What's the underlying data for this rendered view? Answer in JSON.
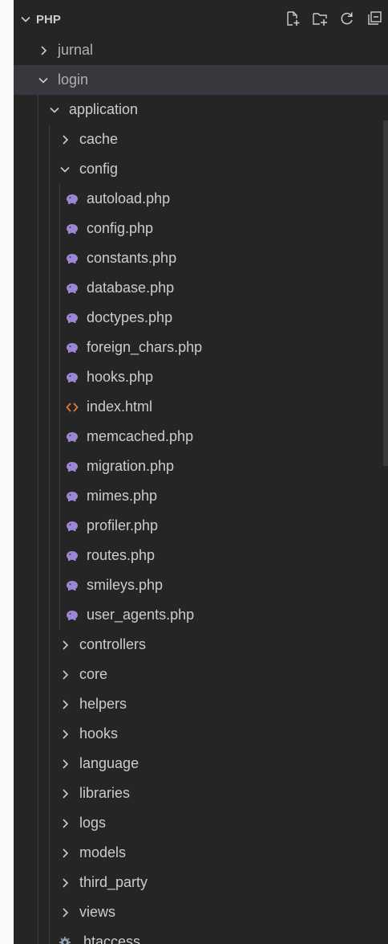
{
  "explorer": {
    "section_title": "PHP",
    "actions": [
      {
        "name": "new-file-icon"
      },
      {
        "name": "new-folder-icon"
      },
      {
        "name": "refresh-icon"
      },
      {
        "name": "collapse-all-icon"
      }
    ]
  },
  "tree": [
    {
      "label": "jurnal",
      "type": "folder",
      "expanded": false,
      "depth": 1
    },
    {
      "label": "login",
      "type": "folder",
      "expanded": true,
      "depth": 1,
      "selected": true
    },
    {
      "label": "application",
      "type": "folder",
      "expanded": true,
      "depth": 2
    },
    {
      "label": "cache",
      "type": "folder",
      "expanded": false,
      "depth": 3
    },
    {
      "label": "config",
      "type": "folder",
      "expanded": true,
      "depth": 3
    },
    {
      "label": "autoload.php",
      "type": "php",
      "depth": 4
    },
    {
      "label": "config.php",
      "type": "php",
      "depth": 4
    },
    {
      "label": "constants.php",
      "type": "php",
      "depth": 4
    },
    {
      "label": "database.php",
      "type": "php",
      "depth": 4
    },
    {
      "label": "doctypes.php",
      "type": "php",
      "depth": 4
    },
    {
      "label": "foreign_chars.php",
      "type": "php",
      "depth": 4
    },
    {
      "label": "hooks.php",
      "type": "php",
      "depth": 4
    },
    {
      "label": "index.html",
      "type": "html",
      "depth": 4
    },
    {
      "label": "memcached.php",
      "type": "php",
      "depth": 4
    },
    {
      "label": "migration.php",
      "type": "php",
      "depth": 4
    },
    {
      "label": "mimes.php",
      "type": "php",
      "depth": 4
    },
    {
      "label": "profiler.php",
      "type": "php",
      "depth": 4
    },
    {
      "label": "routes.php",
      "type": "php",
      "depth": 4
    },
    {
      "label": "smileys.php",
      "type": "php",
      "depth": 4
    },
    {
      "label": "user_agents.php",
      "type": "php",
      "depth": 4
    },
    {
      "label": "controllers",
      "type": "folder",
      "expanded": false,
      "depth": 3
    },
    {
      "label": "core",
      "type": "folder",
      "expanded": false,
      "depth": 3
    },
    {
      "label": "helpers",
      "type": "folder",
      "expanded": false,
      "depth": 3
    },
    {
      "label": "hooks",
      "type": "folder",
      "expanded": false,
      "depth": 3
    },
    {
      "label": "language",
      "type": "folder",
      "expanded": false,
      "depth": 3
    },
    {
      "label": "libraries",
      "type": "folder",
      "expanded": false,
      "depth": 3
    },
    {
      "label": "logs",
      "type": "folder",
      "expanded": false,
      "depth": 3
    },
    {
      "label": "models",
      "type": "folder",
      "expanded": false,
      "depth": 3
    },
    {
      "label": "third_party",
      "type": "folder",
      "expanded": false,
      "depth": 3
    },
    {
      "label": "views",
      "type": "folder",
      "expanded": false,
      "depth": 3
    },
    {
      "label": ".htaccess",
      "type": "config",
      "depth": 3
    }
  ],
  "colors": {
    "background": "#252526",
    "selected": "#37373d",
    "text": "#cccccc",
    "php_icon": "#9b87d4",
    "html_icon": "#e37933",
    "gear_icon": "#8fa0b3"
  }
}
